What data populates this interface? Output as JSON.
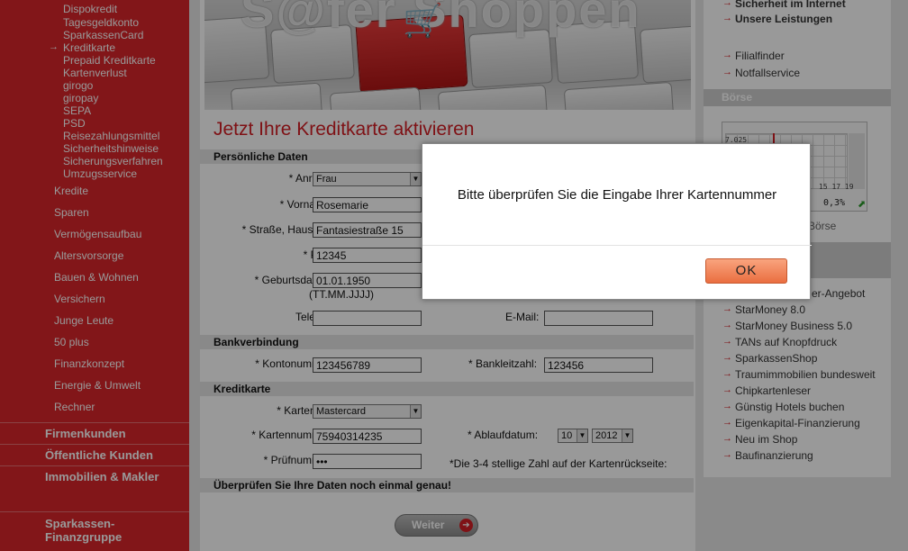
{
  "sidebar": {
    "sub_items": [
      "Dispokredit",
      "Tagesgeldkonto",
      "SparkassenCard",
      "Kreditkarte",
      "Prepaid Kreditkarte",
      "Kartenverlust",
      "girogo",
      "giropay",
      "SEPA",
      "PSD",
      "Reisezahlungsmittel",
      "Sicherheitshinweise",
      "Sicherungsverfahren",
      "Umzugsservice"
    ],
    "main_items": [
      "Kredite",
      "Sparen",
      "Vermögensaufbau",
      "Altersvorsorge",
      "Bauen & Wohnen",
      "Versichern",
      "Junge Leute",
      "50 plus",
      "Finanzkonzept",
      "Energie & Umwelt",
      "Rechner"
    ],
    "sections": [
      "Firmenkunden",
      "Öffentliche Kunden",
      "Immobilien & Makler"
    ],
    "group_line1": "Sparkassen-",
    "group_line2": "Finanzgruppe"
  },
  "banner": {
    "text": "S@fer Shoppen",
    "cart_icon": "shopping-cart-icon"
  },
  "form": {
    "title": "Jetzt Ihre Kreditkarte aktivieren",
    "section_personal": "Persönliche Daten",
    "section_bank": "Bankverbindung",
    "section_card": "Kreditkarte",
    "section_check": "Überprüfen Sie Ihre Daten noch einmal genau!",
    "labels": {
      "anrede": "* Anrede:",
      "vorname": "* Vorname:",
      "strasse": "* Straße, Haus-Nr.:",
      "plz": "* PLZ:",
      "geburtsdatum": "* Geburtsdatum:",
      "date_format": "(TT.MM.JJJJ)",
      "telefon": "Telefon:",
      "email": "E-Mail:",
      "kontonummer": "* Kontonummer:",
      "bankleitzahl": "* Bankleitzahl:",
      "kartentyp": "* Kartentyp:",
      "kartennummer": "* Kartennummer:",
      "ablaufdatum": "* Ablaufdatum:",
      "pruefnummer": "* Prüfnummer:",
      "pruef_hint": "*Die 3-4 stellige Zahl auf der Kartenrückseite:"
    },
    "values": {
      "anrede": "Frau",
      "vorname": "Rosemarie",
      "strasse": "Fantasiestraße 15",
      "plz": "12345",
      "geburtsdatum": "01.01.1950",
      "telefon": "",
      "email": "",
      "kontonummer": "123456789",
      "bankleitzahl": "123456",
      "kartentyp": "Mastercard",
      "kartennummer": "75940314235",
      "ablauf_monat": "10",
      "ablauf_jahr": "2012",
      "pruefnummer": "•••"
    },
    "submit_label": "Weiter"
  },
  "right": {
    "top_links": [
      "Sicherheit im Internet",
      "Unsere Leistungen"
    ],
    "links2": [
      "Filialfinder",
      "Notfallservice"
    ],
    "boerse_header": "Börse",
    "chart_value": "7.025",
    "chart_ticks": "15   17   19",
    "chart_change": "0,3%",
    "boerse_link": "Börse",
    "offer_text": "er-Angebot",
    "links3": [
      "StarMoney 8.0",
      "StarMoney Business 5.0",
      "TANs auf Knopfdruck",
      "SparkassenShop",
      "Traumimmobilien bundesweit",
      "Chipkartenleser",
      "Günstig Hotels buchen",
      "Eigenkapital-Finanzierung",
      "Neu im Shop",
      "Baufinanzierung"
    ]
  },
  "dialog": {
    "message": "Bitte überprüfen Sie die Eingabe Ihrer Kartennummer",
    "ok_label": "OK"
  },
  "colors": {
    "brand_red": "#d9262a",
    "ok_orange": "#ea6e40"
  }
}
